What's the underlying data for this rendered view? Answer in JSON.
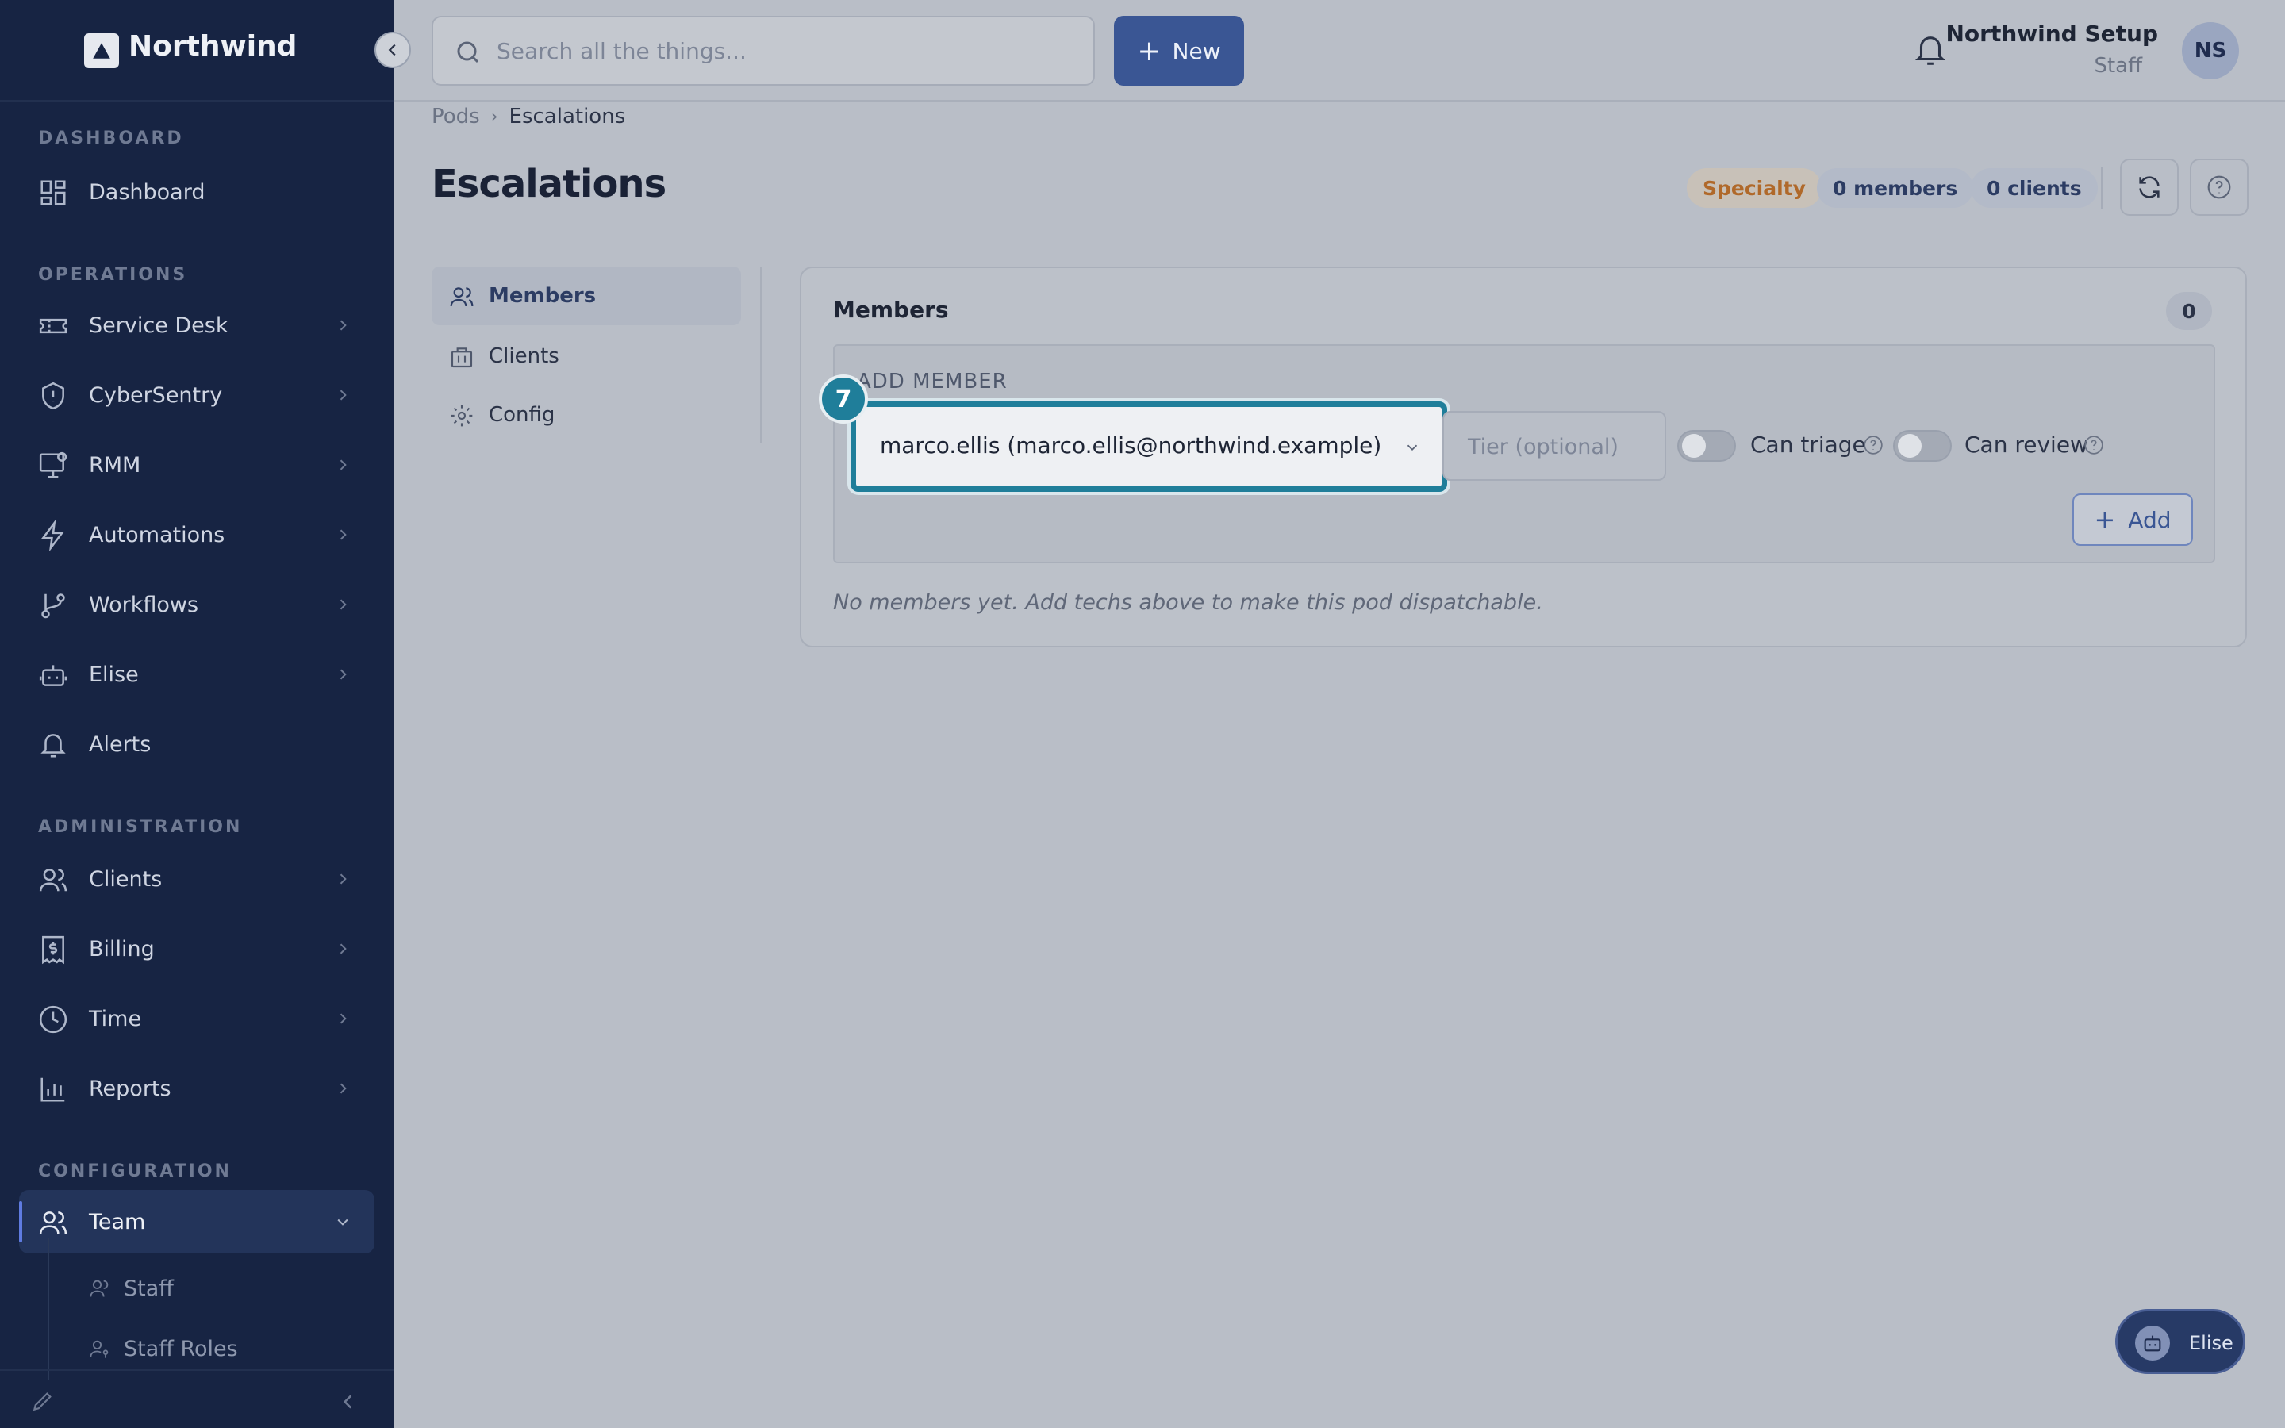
{
  "brand": {
    "name": "Northwind"
  },
  "sidebar": {
    "sections": [
      "DASHBOARD",
      "OPERATIONS",
      "ADMINISTRATION",
      "CONFIGURATION"
    ],
    "items": [
      {
        "label": "Dashboard",
        "icon": "dashboard-icon"
      },
      {
        "label": "Service Desk",
        "icon": "ticket-icon"
      },
      {
        "label": "CyberSentry",
        "icon": "shield-icon"
      },
      {
        "label": "RMM",
        "icon": "monitor-icon"
      },
      {
        "label": "Automations",
        "icon": "lightning-icon"
      },
      {
        "label": "Workflows",
        "icon": "git-branch-icon"
      },
      {
        "label": "Elise",
        "icon": "robot-icon"
      },
      {
        "label": "Alerts",
        "icon": "bell-icon"
      },
      {
        "label": "Clients",
        "icon": "users-icon"
      },
      {
        "label": "Billing",
        "icon": "receipt-icon"
      },
      {
        "label": "Time",
        "icon": "clock-icon"
      },
      {
        "label": "Reports",
        "icon": "bar-chart-icon"
      },
      {
        "label": "Team",
        "icon": "users-icon"
      }
    ],
    "sub_items": [
      {
        "label": "Staff"
      },
      {
        "label": "Staff Roles"
      }
    ]
  },
  "topbar": {
    "search_placeholder": "Search all the things...",
    "new_label": "New",
    "user_name": "Northwind Setup",
    "user_role": "Staff",
    "avatar_initials": "NS"
  },
  "breadcrumb": {
    "parent": "Pods",
    "current": "Escalations"
  },
  "page": {
    "title": "Escalations",
    "badges": {
      "specialty": "Specialty",
      "members": "0 members",
      "clients": "0 clients"
    }
  },
  "tabs": [
    {
      "label": "Members",
      "active": true
    },
    {
      "label": "Clients",
      "active": false
    },
    {
      "label": "Config",
      "active": false
    }
  ],
  "members_card": {
    "title": "Members",
    "count": "0",
    "add_member_label": "ADD MEMBER",
    "selected_member": "marco.ellis (marco.ellis@northwind.example)",
    "tier_placeholder": "Tier (optional)",
    "can_triage_label": "Can triage",
    "can_review_label": "Can review",
    "add_button_label": "Add",
    "empty_text": "No members yet. Add techs above to make this pod dispatchable."
  },
  "step_marker": "7",
  "elise_fab": {
    "label": "Elise"
  },
  "colors": {
    "sidebar": "#172443",
    "accent": "#3a5694",
    "focus": "#1f7e9a",
    "specialty": "#b0692a"
  }
}
